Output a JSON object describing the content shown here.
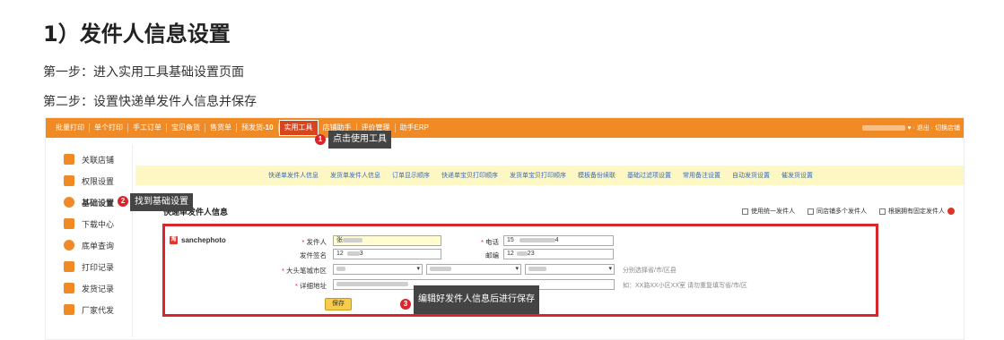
{
  "doc": {
    "title": "1）发件人信息设置",
    "step1": "第一步：进入实用工具基础设置页面",
    "step2": "第二步：设置快递单发件人信息并保存"
  },
  "topbar": {
    "items": [
      "批量打印",
      "单个打印",
      "手工订单",
      "宝贝备货",
      "售货单",
      "预发货",
      "实用工具",
      "店铺助手",
      "评价管理",
      "助手ERP"
    ],
    "pending_count": "-10",
    "right": "· 退出 · 切换店铺"
  },
  "sidebar": {
    "items": [
      "关联店铺",
      "权限设置",
      "基础设置",
      "下载中心",
      "底单查询",
      "打印记录",
      "发货记录",
      "厂家代发"
    ]
  },
  "subnav": {
    "items": [
      "快递单发件人信息",
      "发货单发件人信息",
      "订单显示顺序",
      "快递单宝贝打印顺序",
      "发货单宝贝打印顺序",
      "模板备份续联",
      "基础过滤项设置",
      "常用备注设置",
      "自动发货设置",
      "催发货设置"
    ]
  },
  "section": {
    "title": "快递单发件人信息",
    "opt1": "使用统一发件人",
    "opt2": "同店铺多个发件人",
    "opt3": "根据拥有固定发件人"
  },
  "form": {
    "shop_name": "sanchephoto",
    "sender_label": "发件人",
    "sender_value": "张",
    "phone_label": "电话",
    "phone_value": "15",
    "phone_value_end": "4",
    "sign_label": "发件签名",
    "sign_value": "12",
    "sign_value_end": "3",
    "zip_label": "邮编",
    "zip_value": "12",
    "zip_value_end": "23",
    "area_label": "大头笔城市区",
    "area_hint": "分别选择省/市/区县",
    "addr_label": "详细地址",
    "addr_hint": "如：XX路XX小区XX室 请勿重复填写省/市/区",
    "save_label": "保存"
  },
  "annotations": {
    "c1_num": "1",
    "c1_text": "点击使用工具",
    "c2_num": "2",
    "c2_text": "找到基础设置",
    "c3_num": "3",
    "c3_text": "编辑好发件人信息后进行保存"
  },
  "colors": {
    "topbar": "#f08a24",
    "active_tab": "#d8451d",
    "highlight_box": "#d8262c",
    "subnav_bg": "#fdf7c3",
    "save_button": "#f5cc4c"
  }
}
